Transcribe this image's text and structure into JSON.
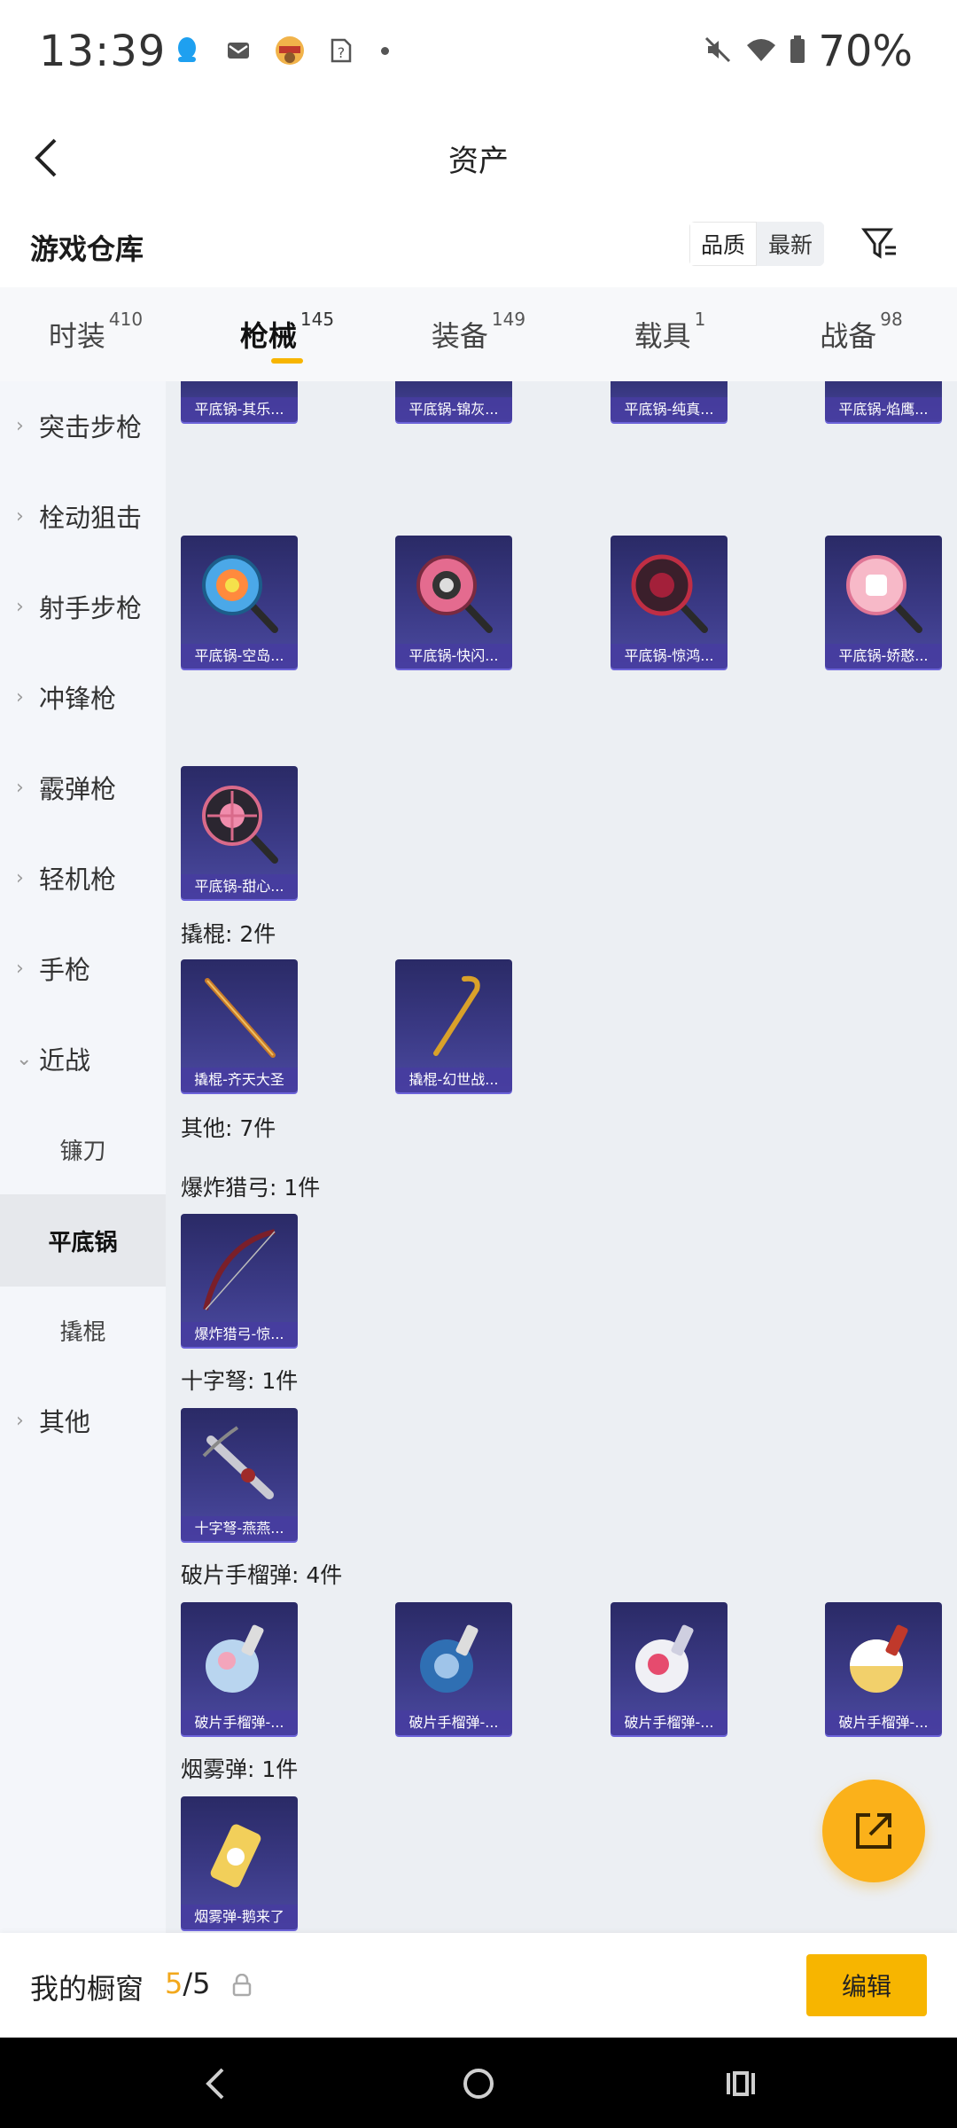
{
  "status_bar": {
    "time": "13:39",
    "battery_text": "70%",
    "icons": [
      "qq-icon",
      "mail-icon",
      "app-badge-icon",
      "sim-question-icon",
      "dot-icon",
      "mute-icon",
      "wifi-icon",
      "battery-icon"
    ]
  },
  "header": {
    "title": "资产"
  },
  "warehouse": {
    "title": "游戏仓库",
    "sort_quality": "品质",
    "sort_newest": "最新"
  },
  "tabs": [
    {
      "label": "时装",
      "count": "410"
    },
    {
      "label": "枪械",
      "count": "145",
      "active": true
    },
    {
      "label": "装备",
      "count": "149"
    },
    {
      "label": "载具",
      "count": "1"
    },
    {
      "label": "战备",
      "count": "98"
    }
  ],
  "sidebar": {
    "items": [
      {
        "label": "突击步枪"
      },
      {
        "label": "栓动狙击"
      },
      {
        "label": "射手步枪"
      },
      {
        "label": "冲锋枪"
      },
      {
        "label": "霰弹枪"
      },
      {
        "label": "轻机枪"
      },
      {
        "label": "手枪"
      },
      {
        "label": "近战",
        "expanded": true
      },
      {
        "label": "镰刀"
      },
      {
        "label": "平底锅",
        "selected": true
      },
      {
        "label": "撬棍"
      },
      {
        "label": "其他"
      }
    ]
  },
  "content": {
    "partial_row": [
      "平底锅-其乐...",
      "平底锅-锦灰...",
      "平底锅-纯真...",
      "平底锅-焰鹰..."
    ],
    "pan_row_2": [
      "平底锅-空岛...",
      "平底锅-快闪...",
      "平底锅-惊鸿...",
      "平底锅-娇憨..."
    ],
    "pan_row_3": [
      "平底锅-甜心..."
    ],
    "crowbar_header": "撬棍: 2件",
    "crowbar_items": [
      "撬棍-齐天大圣",
      "撬棍-幻世战..."
    ],
    "other_header": "其他: 7件",
    "bow_header": "爆炸猎弓: 1件",
    "bow_items": [
      "爆炸猎弓-惊..."
    ],
    "crossbow_header": "十字弩: 1件",
    "crossbow_items": [
      "十字弩-燕燕..."
    ],
    "grenade_header": "破片手榴弹: 4件",
    "grenade_items": [
      "破片手榴弹-...",
      "破片手榴弹-...",
      "破片手榴弹-...",
      "破片手榴弹-..."
    ],
    "smoke_header": "烟雾弹: 1件",
    "smoke_items": [
      "烟雾弹-鹅来了"
    ]
  },
  "bottom_bar": {
    "title": "我的橱窗",
    "count_current": "5",
    "count_sep_total": "/5",
    "edit_label": "编辑"
  },
  "colors": {
    "accent": "#f7b500",
    "fab": "#fbb11a",
    "card_bg": "#33327a",
    "card_label_bg": "#463ca0",
    "content_bg": "#eceff3"
  }
}
